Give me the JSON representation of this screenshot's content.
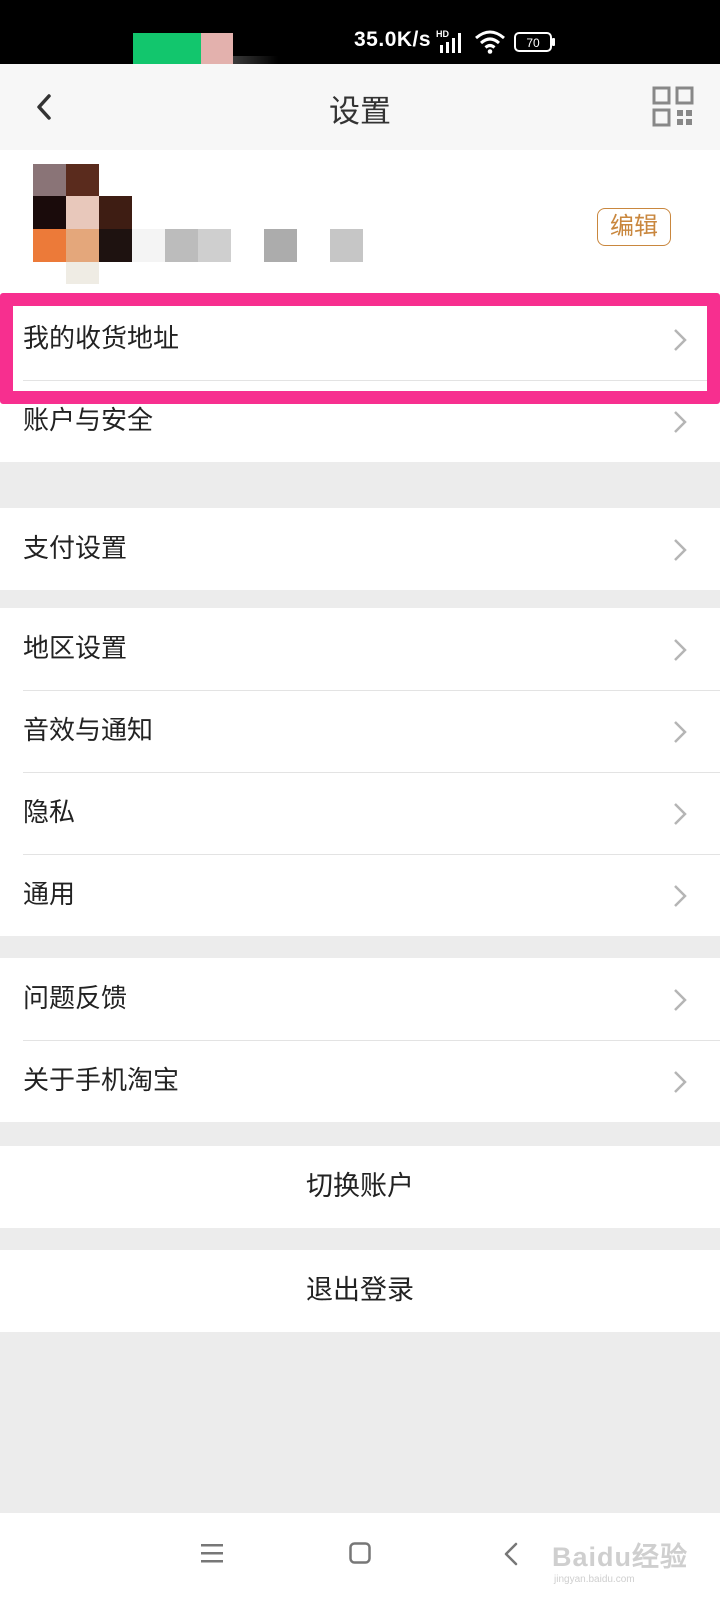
{
  "status_bar": {
    "net_speed": "35.0K/s",
    "network_badge": "HD",
    "battery": "70",
    "icons": [
      "signal-icon",
      "wifi-icon",
      "battery-icon"
    ]
  },
  "header": {
    "title": "设置",
    "back_icon": "back-arrow-icon",
    "qr_icon": "qr-code-icon"
  },
  "profile": {
    "edit_label": "编辑",
    "avatar_note": "pixelated"
  },
  "sections": [
    {
      "items": [
        {
          "label": "我的收货地址",
          "highlighted": true
        },
        {
          "label": "账户与安全"
        }
      ]
    },
    {
      "items": [
        {
          "label": "支付设置"
        }
      ]
    },
    {
      "items": [
        {
          "label": "地区设置"
        },
        {
          "label": "音效与通知"
        },
        {
          "label": "隐私"
        },
        {
          "label": "通用"
        }
      ]
    },
    {
      "items": [
        {
          "label": "问题反馈"
        },
        {
          "label": "关于手机淘宝"
        }
      ]
    }
  ],
  "actions": {
    "switch_account": "切换账户",
    "logout": "退出登录"
  },
  "nav_bar": {
    "icons": [
      "menu-icon",
      "home-icon",
      "back-icon"
    ]
  },
  "watermark": {
    "main": "Baidu经验",
    "sub": "jingyan.baidu.com"
  },
  "colors": {
    "accent_edit": "#c9873e",
    "highlight_border": "#f72f8f",
    "background": "#ececec"
  }
}
